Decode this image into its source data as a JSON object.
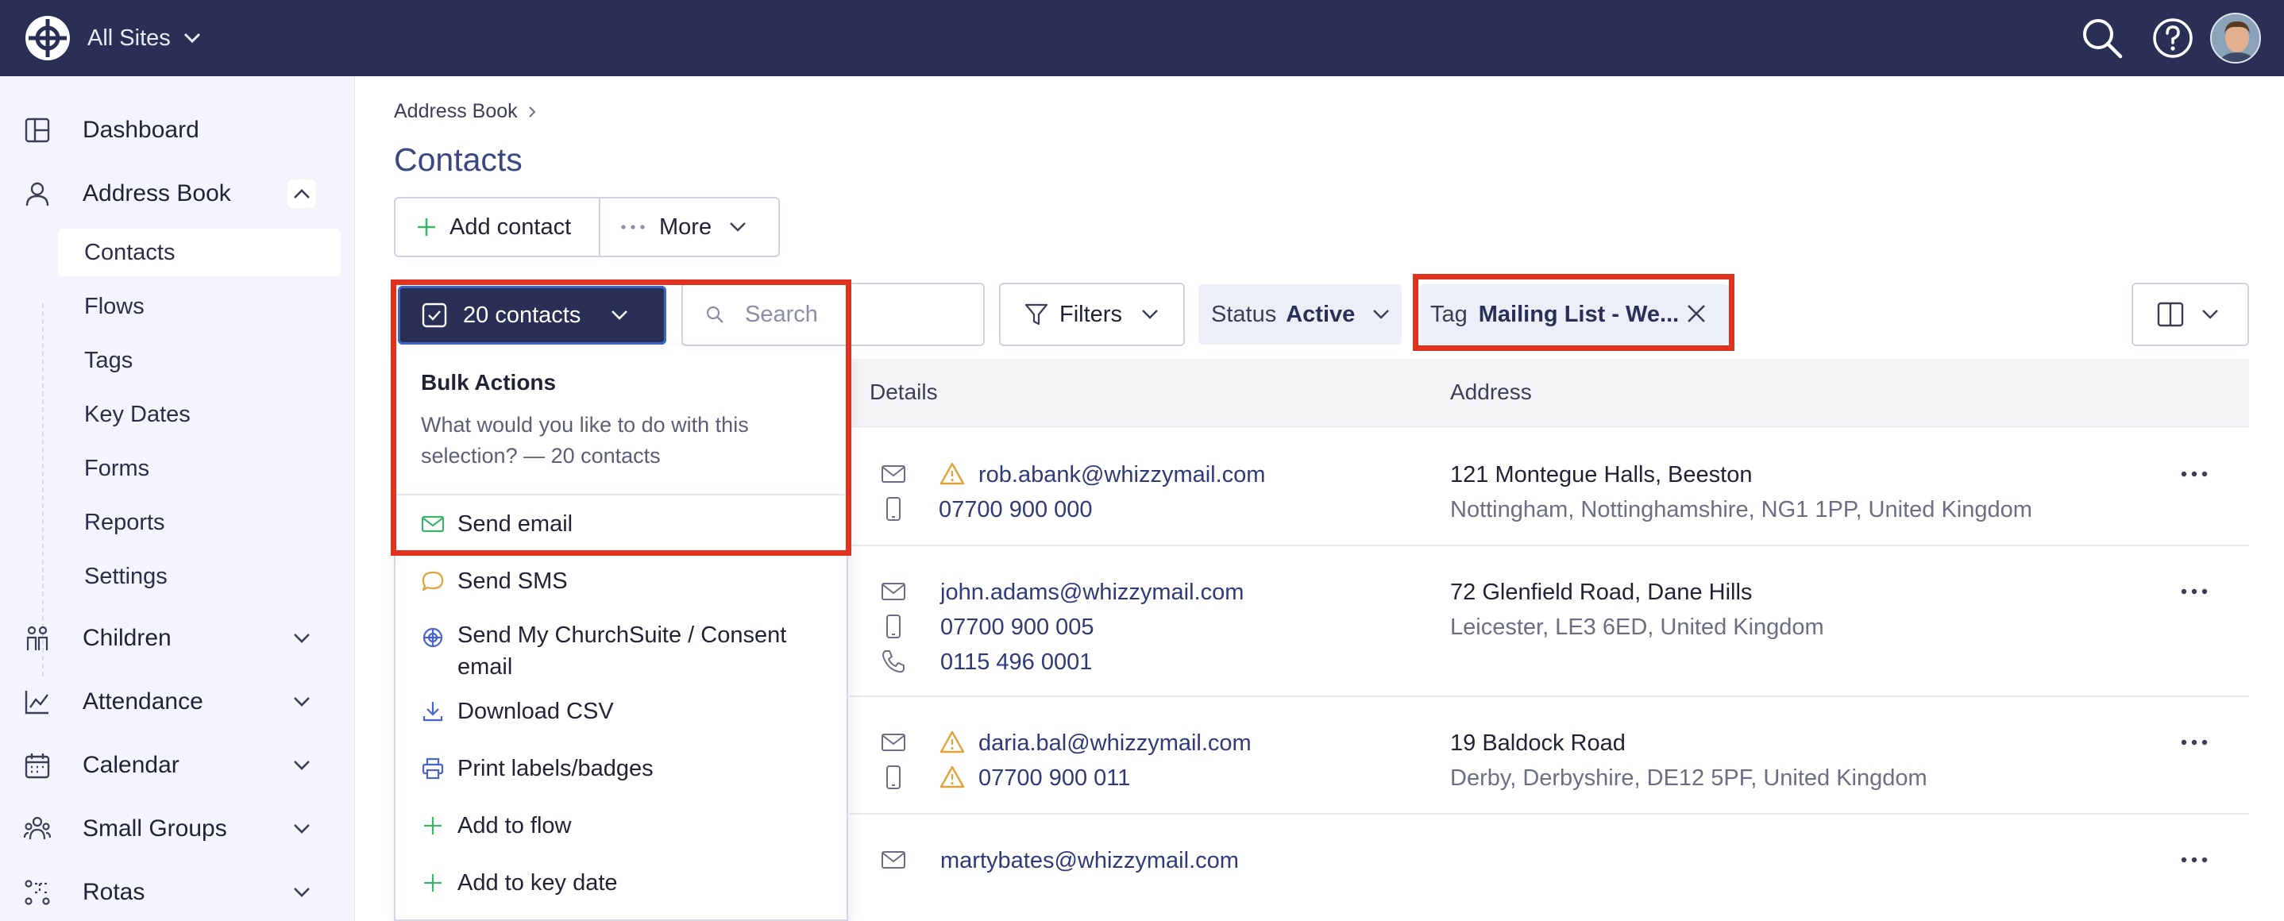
{
  "topbar": {
    "site_label": "All Sites",
    "icons": [
      "logo-icon",
      "search-icon",
      "help-icon",
      "avatar"
    ]
  },
  "sidebar": {
    "items": [
      {
        "label": "Dashboard",
        "icon": "dashboard-icon"
      },
      {
        "label": "Address Book",
        "icon": "person-icon",
        "expanded": true
      },
      {
        "label": "Children",
        "icon": "children-icon"
      },
      {
        "label": "Attendance",
        "icon": "chart-icon"
      },
      {
        "label": "Calendar",
        "icon": "calendar-icon"
      },
      {
        "label": "Small Groups",
        "icon": "group-icon"
      },
      {
        "label": "Rotas",
        "icon": "rota-icon"
      }
    ],
    "sub_items": [
      "Contacts",
      "Flows",
      "Tags",
      "Key Dates",
      "Forms",
      "Reports",
      "Settings"
    ],
    "active_sub": "Contacts"
  },
  "main": {
    "breadcrumb": "Address Book",
    "title": "Contacts",
    "add_contact": "Add contact",
    "more": "More",
    "selection_label": "20 contacts",
    "search_placeholder": "Search",
    "filters": "Filters",
    "status_key": "Status",
    "status_value": "Active",
    "tag_key": "Tag",
    "tag_value": "Mailing List - We..."
  },
  "table": {
    "columns": [
      "Details",
      "Address"
    ],
    "rows": [
      {
        "email": "rob.abank@whizzymail.com",
        "phone": "07700 900 000",
        "addr1": "121 Montegue Halls, Beeston",
        "addr2": "Nottingham, Nottinghamshire, NG1 1PP, United Kingdom"
      },
      {
        "email": "john.adams@whizzymail.com",
        "phone": "07700 900 005",
        "landline": "0115 496 0001",
        "addr1": "72 Glenfield Road, Dane Hills",
        "addr2": "Leicester, LE3 6ED, United Kingdom"
      },
      {
        "email": "daria.bal@whizzymail.com",
        "phone": "07700 900 011",
        "addr1": "19 Baldock Road",
        "addr2": "Derby, Derbyshire, DE12 5PF, United Kingdom"
      },
      {
        "email": "martybates@whizzymail.com"
      }
    ]
  },
  "bulk": {
    "title": "Bulk Actions",
    "description": "What would you like to do with this selection? — 20 contacts",
    "actions": [
      "Send email",
      "Send SMS",
      "Send My ChurchSuite / Consent email",
      "Download CSV",
      "Print labels/badges",
      "Add to flow",
      "Add to key date"
    ]
  },
  "colors": {
    "topbar": "#2a2f55",
    "sidebar": "#f4f5fc",
    "highlight": "#e1311f",
    "link": "#2f3a78",
    "warning": "#e2a23a",
    "success": "#3bb36a"
  }
}
